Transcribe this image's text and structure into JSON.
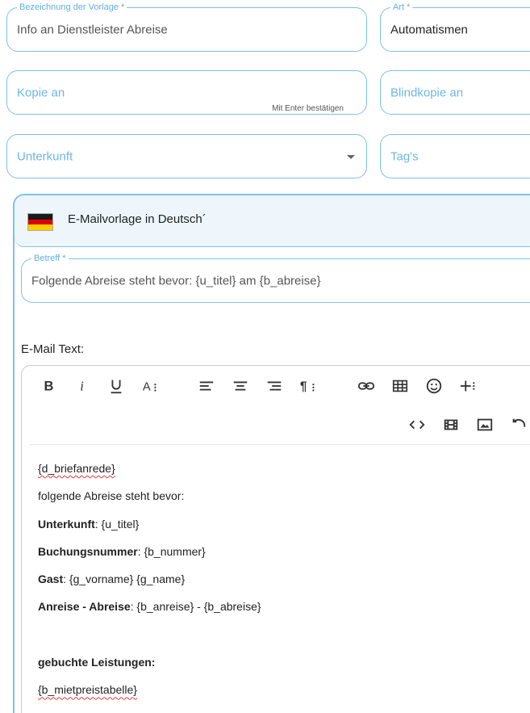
{
  "fields": {
    "template_name": {
      "label": "Bezeichnung der Vorlage *",
      "value": "Info an Dienstleister Abreise"
    },
    "type": {
      "label": "Art *",
      "value": "Automatismen"
    },
    "cc": {
      "placeholder": "Kopie an",
      "hint": "Mit Enter bestätigen"
    },
    "bcc": {
      "placeholder": "Blindkopie an"
    },
    "accommodation": {
      "placeholder": "Unterkunft"
    },
    "tags": {
      "placeholder": "Tag's"
    }
  },
  "panel": {
    "title": "E-Mailvorlage in Deutsch´",
    "flag_colors": [
      "#1a1a1a",
      "#dd0000",
      "#ffce00"
    ],
    "subject": {
      "label": "Betreff *",
      "value": "Folgende Abreise steht bevor: {u_titel} am {b_abreise}"
    },
    "body_label": "E-Mail Text:"
  },
  "toolbar": {
    "row1": [
      "bold-icon",
      "italic-icon",
      "underline-icon",
      "font-size-icon",
      "align-left-icon",
      "align-center-icon",
      "align-right-icon",
      "paragraph-icon",
      "link-icon",
      "table-icon",
      "emoji-icon",
      "insert-more-icon"
    ],
    "row2": [
      "code-view-icon",
      "video-icon",
      "image-icon",
      "undo-icon"
    ]
  },
  "editor": {
    "lines": [
      {
        "text": "{d_briefanrede}"
      },
      {
        "text": "folgende Abreise steht bevor:"
      },
      {
        "label": "Unterkunft",
        "rest": ": {u_titel}"
      },
      {
        "label": "Buchungsnummer",
        "rest": ": {b_nummer}"
      },
      {
        "label": "Gast",
        "rest": ": {g_vorname} {g_name}"
      },
      {
        "label": "Anreise - Abreise",
        "rest": ": {b_anreise} - {b_abreise}"
      },
      {
        "text": ""
      },
      {
        "label": "gebuchte Leistungen:",
        "rest": ""
      },
      {
        "text": "{b_mietpreistabelle}"
      }
    ]
  }
}
